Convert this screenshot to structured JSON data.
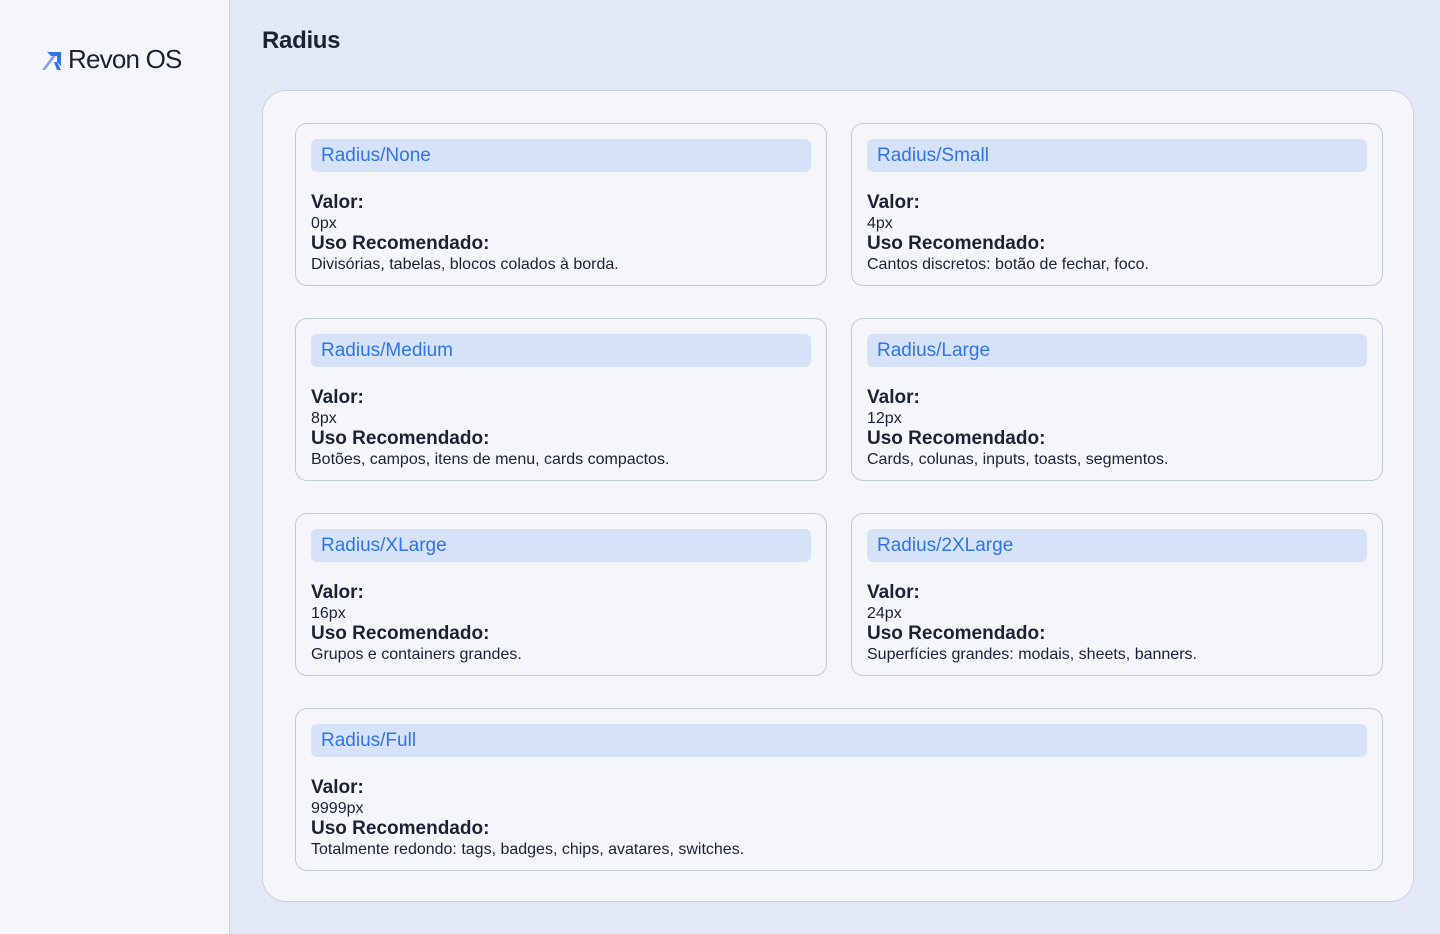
{
  "sidebar": {
    "brand_name": "Revon OS",
    "brand_icon": "arrow-up-right-icon",
    "brand_color": "#2f74ea"
  },
  "page": {
    "title": "Radius"
  },
  "labels": {
    "value": "Valor:",
    "usage": "Uso Recomendado:"
  },
  "tokens": [
    {
      "name": "Radius/None",
      "value": "0px",
      "usage": "Divisórias, tabelas, blocos colados à borda."
    },
    {
      "name": "Radius/Small",
      "value": "4px",
      "usage": "Cantos discretos: botão de fechar, foco."
    },
    {
      "name": "Radius/Medium",
      "value": "8px",
      "usage": "Botões, campos, itens de menu, cards compactos."
    },
    {
      "name": "Radius/Large",
      "value": "12px",
      "usage": "Cards, colunas, inputs, toasts, segmentos."
    },
    {
      "name": "Radius/XLarge",
      "value": "16px",
      "usage": "Grupos e containers grandes."
    },
    {
      "name": "Radius/2XLarge",
      "value": "24px",
      "usage": "Superfícies grandes: modais, sheets, banners."
    },
    {
      "name": "Radius/Full",
      "value": "9999px",
      "usage": "Totalmente redondo: tags, badges, chips, avatares, switches."
    }
  ],
  "colors": {
    "accent": "#2f74ea",
    "header_bg": "#d6e2f8",
    "page_bg": "#e3e9f4",
    "surface": "#f4f6fa",
    "border": "#c3cad8"
  }
}
